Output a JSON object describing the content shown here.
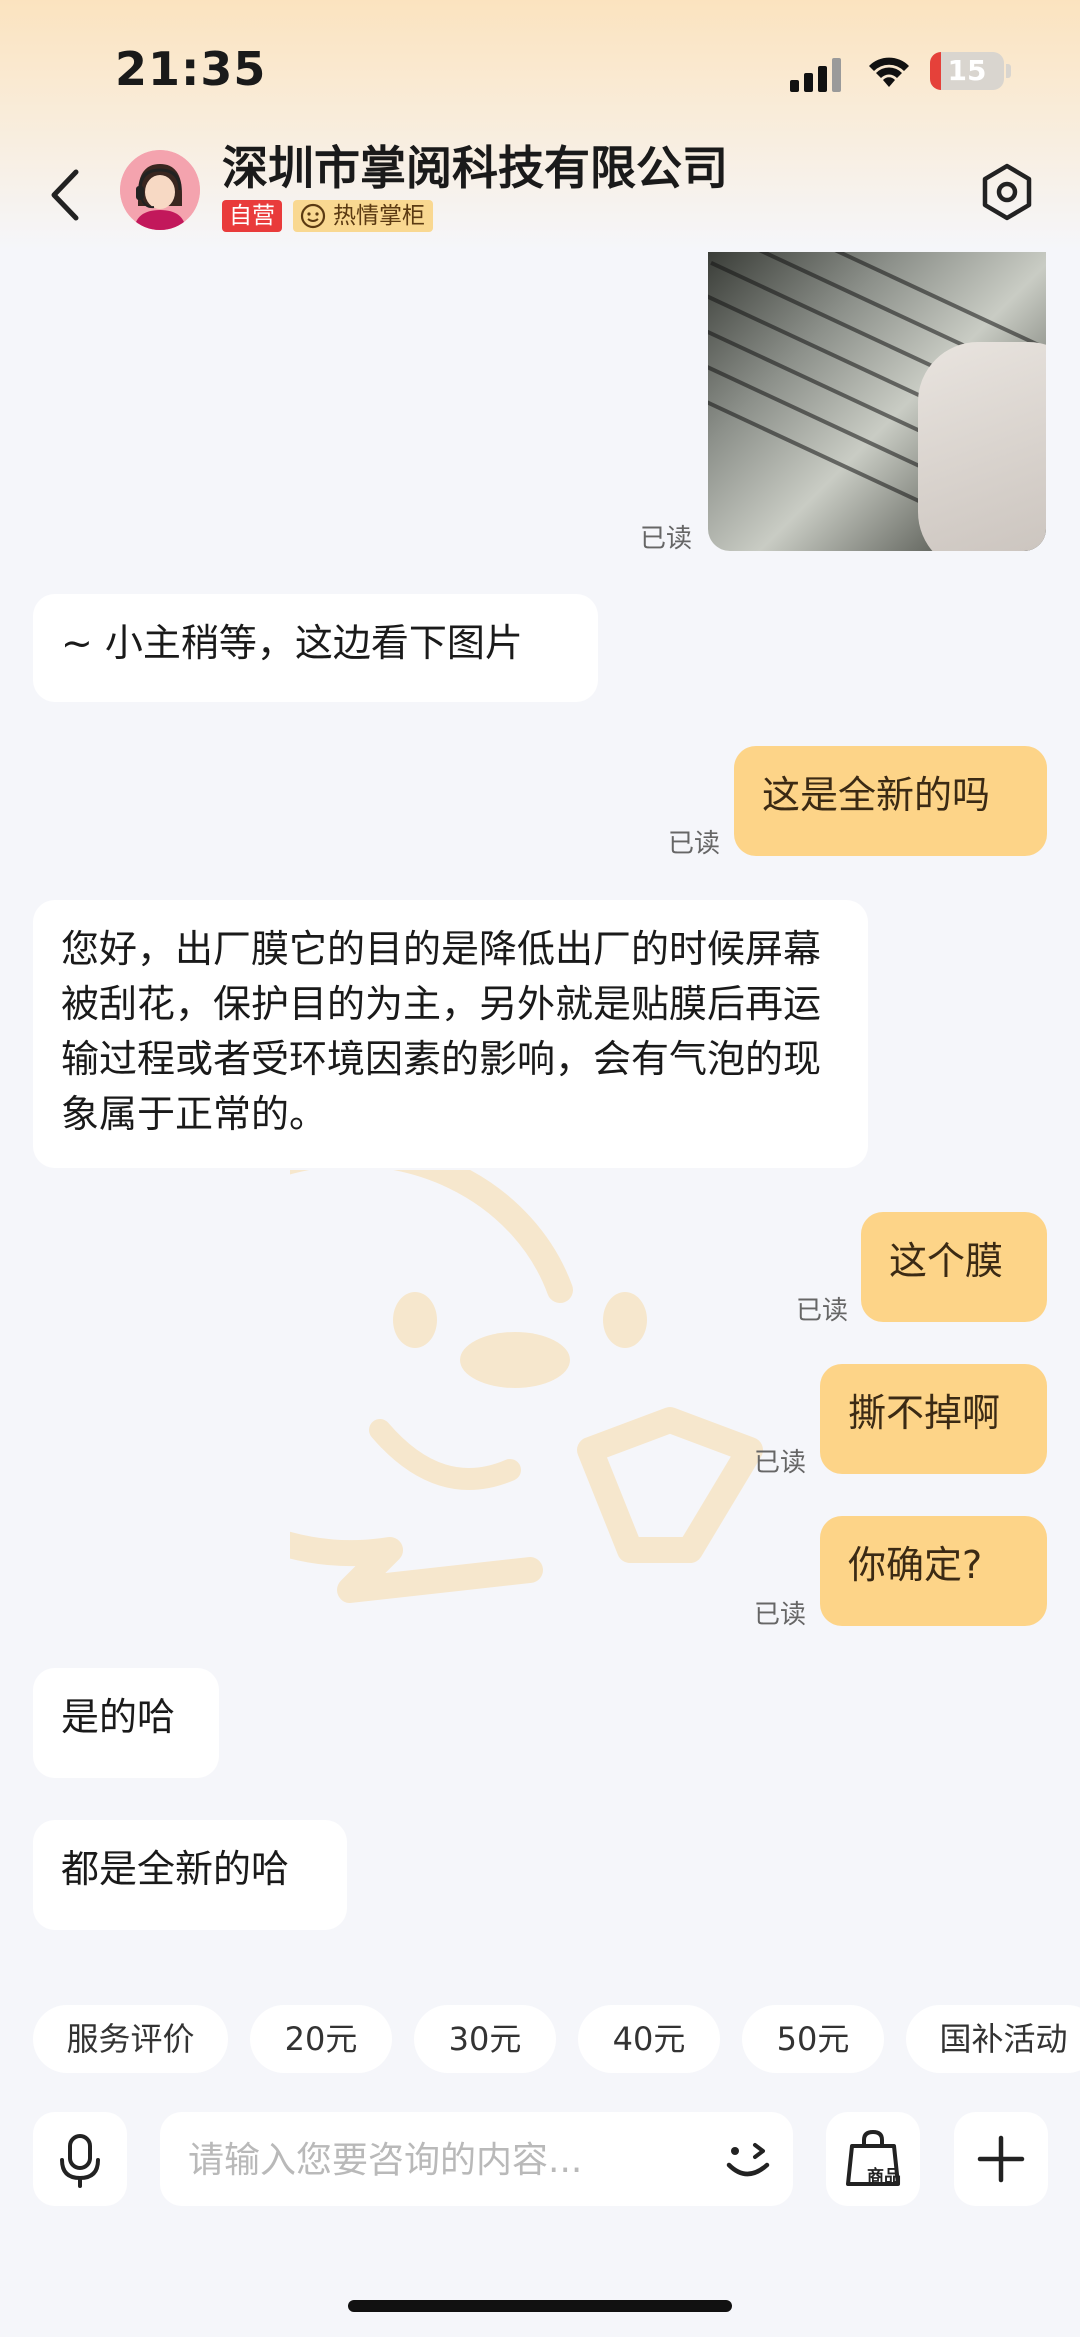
{
  "status_bar": {
    "time": "21:35",
    "battery": "15",
    "battery_level": 0.15
  },
  "header": {
    "shop_name": "深圳市掌阅科技有限公司",
    "badge_self": "自营",
    "badge_host": "热情掌柜"
  },
  "messages": {
    "image_read": "已读",
    "m1": {
      "text": "~ 小主稍等，这边看下图片"
    },
    "m2": {
      "text": "这是全新的吗",
      "read": "已读"
    },
    "m3": {
      "text": "您好，出厂膜它的目的是降低出厂的时候屏幕被刮花，保护目的为主，另外就是贴膜后再运输过程或者受环境因素的影响，会有气泡的现象属于正常的。"
    },
    "m4": {
      "text": "这个膜",
      "read": "已读"
    },
    "m5": {
      "text": "撕不掉啊",
      "read": "已读"
    },
    "m6": {
      "text": "你确定?",
      "read": "已读"
    },
    "m7": {
      "text": "是的哈"
    },
    "m8": {
      "text": "都是全新的哈"
    }
  },
  "quick_replies": [
    "服务评价",
    "20元",
    "30元",
    "40元",
    "50元",
    "国补活动"
  ],
  "input": {
    "placeholder": "请输入您要咨询的内容...",
    "goods_label": "商品"
  },
  "colors": {
    "accent": "#fdd488",
    "badge_red": "#e93b3b",
    "badge_gold": "#f9d891",
    "background": "#f5f6fa"
  }
}
